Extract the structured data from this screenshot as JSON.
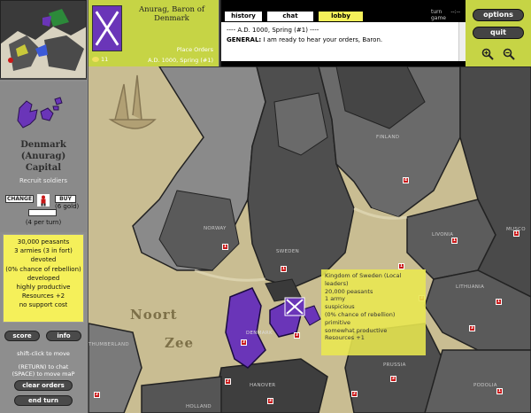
{
  "region": {
    "name_line1": "Denmark",
    "name_line2": "(Anurag)",
    "name_line3": "Capital",
    "recruit_label": "Recruit soldiers",
    "change_label": "CHANGE",
    "buy_label": "BUY",
    "gold_cost": "(6 gold)",
    "per_turn": "(4 per turn)"
  },
  "stats": [
    "30,000 peasants",
    "3 armies (3 in fort)",
    "devoted",
    "(0% chance of rebellion)",
    "developed",
    "highly productive",
    "Resources +2",
    "no support cost"
  ],
  "buttons": {
    "score": "score",
    "info": "info",
    "clear_orders": "clear orders",
    "end_turn": "end turn",
    "options": "options",
    "quit": "quit"
  },
  "hints": {
    "shift_click": "shift-click to move",
    "return_chat": "(RETURN) to chat",
    "space_move": "(SPACE) to move maP"
  },
  "player": {
    "title_line1": "Anurag, Baron of",
    "title_line2": "Denmark",
    "place_orders": "Place Orders",
    "date": "A.D. 1000, Spring (#1)",
    "gold": "11"
  },
  "tabs": [
    "history",
    "chat",
    "lobby"
  ],
  "messages": {
    "line1": "---- A.D. 1000, Spring (#1) ----",
    "line2_speaker": "GENERAL:",
    "line2_text": " I am ready to hear your orders, Baron."
  },
  "turn_game": {
    "line1": "turn",
    "line2": "game",
    "value": "--:--"
  },
  "map": {
    "labels": {
      "noort": "Noort",
      "zee": "Zee",
      "norway": "NORWAY",
      "sweden": "SWEDEN",
      "finland": "FINLAND",
      "livonia": "LIVONIA",
      "muscovy": "MUSCO",
      "lithuania": "LITHUANIA",
      "prussia": "PRUSSIA",
      "podolia": "PODOLIA",
      "hanover": "HANOVER",
      "holland": "HOLLAND",
      "denmark": "DENMARK",
      "northumberland": "THUMBERLAND"
    },
    "armies": [
      "3",
      "4",
      "1",
      "1",
      "1",
      "1",
      "3",
      "3",
      "3",
      "2",
      "2",
      "3",
      "1",
      "2",
      "3",
      "1",
      "1"
    ]
  },
  "tooltip": [
    "Kingdom of Sweden (Local",
    "leaders)",
    "20,000 peasants",
    "1 army",
    "suspicious",
    "(0% chance of rebellion)",
    "primitive",
    "somewhat productive",
    "Resources +1"
  ],
  "colors": {
    "player": "#6a35b8",
    "panel_accent": "#c6d445",
    "stats_bg": "#f5f05a",
    "army_marker": "#c81818"
  }
}
